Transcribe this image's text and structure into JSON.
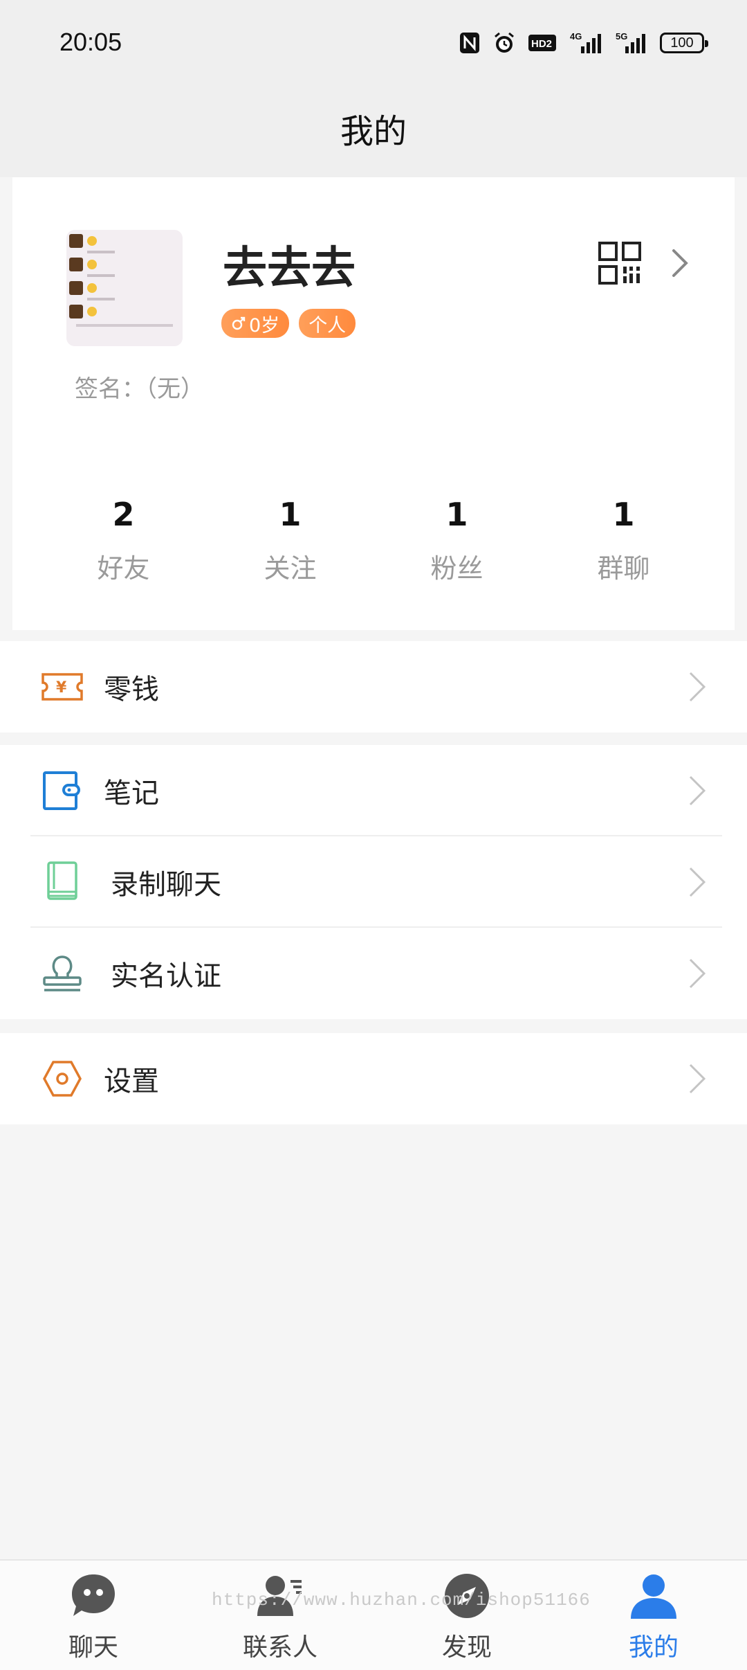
{
  "status": {
    "time": "20:05",
    "battery": "100",
    "icons": [
      "nfc-icon",
      "alarm-icon",
      "hd-icon",
      "signal-4g-icon",
      "signal-5g-icon",
      "battery-icon"
    ]
  },
  "header": {
    "title": "我的"
  },
  "profile": {
    "nickname": "去去去",
    "gender_age": "0岁",
    "type_tag": "个人",
    "signature": "签名：（无）",
    "stats": [
      {
        "count": "2",
        "label": "好友"
      },
      {
        "count": "1",
        "label": "关注"
      },
      {
        "count": "1",
        "label": "粉丝"
      },
      {
        "count": "1",
        "label": "群聊"
      }
    ]
  },
  "menu": {
    "wallet": "零钱",
    "notes": "笔记",
    "record_chat": "录制聊天",
    "verification": "实名认证",
    "settings": "设置"
  },
  "nav": [
    {
      "label": "聊天",
      "icon": "chat-icon",
      "active": false
    },
    {
      "label": "联系人",
      "icon": "contacts-icon",
      "active": false
    },
    {
      "label": "发现",
      "icon": "compass-icon",
      "active": false
    },
    {
      "label": "我的",
      "icon": "me-icon",
      "active": true
    }
  ],
  "watermark": "https://www.huzhan.com/ishop51166",
  "colors": {
    "accent": "#2b7de9",
    "tag": "#ff8a3d",
    "wallet": "#e07a2a",
    "notes": "#1f7fd6",
    "record": "#6fcf97",
    "verify": "#5d8a86",
    "settings": "#e07a2a"
  }
}
